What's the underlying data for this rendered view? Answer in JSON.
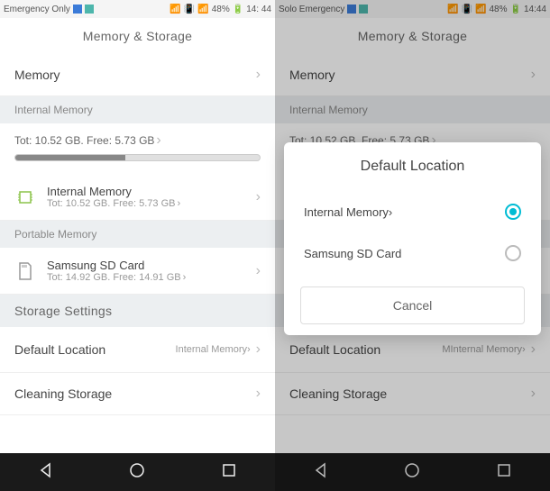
{
  "statusBar": {
    "left": {
      "carrier": "Emergency Only",
      "carrierRight": "Solo Emergency"
    },
    "right": {
      "battery": "48%",
      "time": "14: 44",
      "timeRight": "14:44"
    }
  },
  "title": "Memory & Storage",
  "memoryRow": {
    "label": "Memory"
  },
  "internalSection": {
    "header": "Internal Memory",
    "totFree": "Tot: 10.52 GB. Free: 5.73 GB"
  },
  "internalItem": {
    "name": "Internal Memory",
    "sub": "Tot: 10.52 GB. Free: 5.73 GB"
  },
  "portableSection": {
    "header": "Portable Memory"
  },
  "sdItem": {
    "name": "Samsung SD Card",
    "sub": "Tot: 14.92 GB. Free: 14.91 GB"
  },
  "storageSettings": {
    "title": "Storage Settings"
  },
  "defaultLocation": {
    "label": "Default Location",
    "value": "Internal Memory",
    "valueRight": "MInternal Memory"
  },
  "cleaning": {
    "label": "Cleaning Storage"
  },
  "dialog": {
    "title": "Default Location",
    "option1": "Internal Memory",
    "option2": "Samsung SD Card",
    "cancel": "Cancel"
  }
}
